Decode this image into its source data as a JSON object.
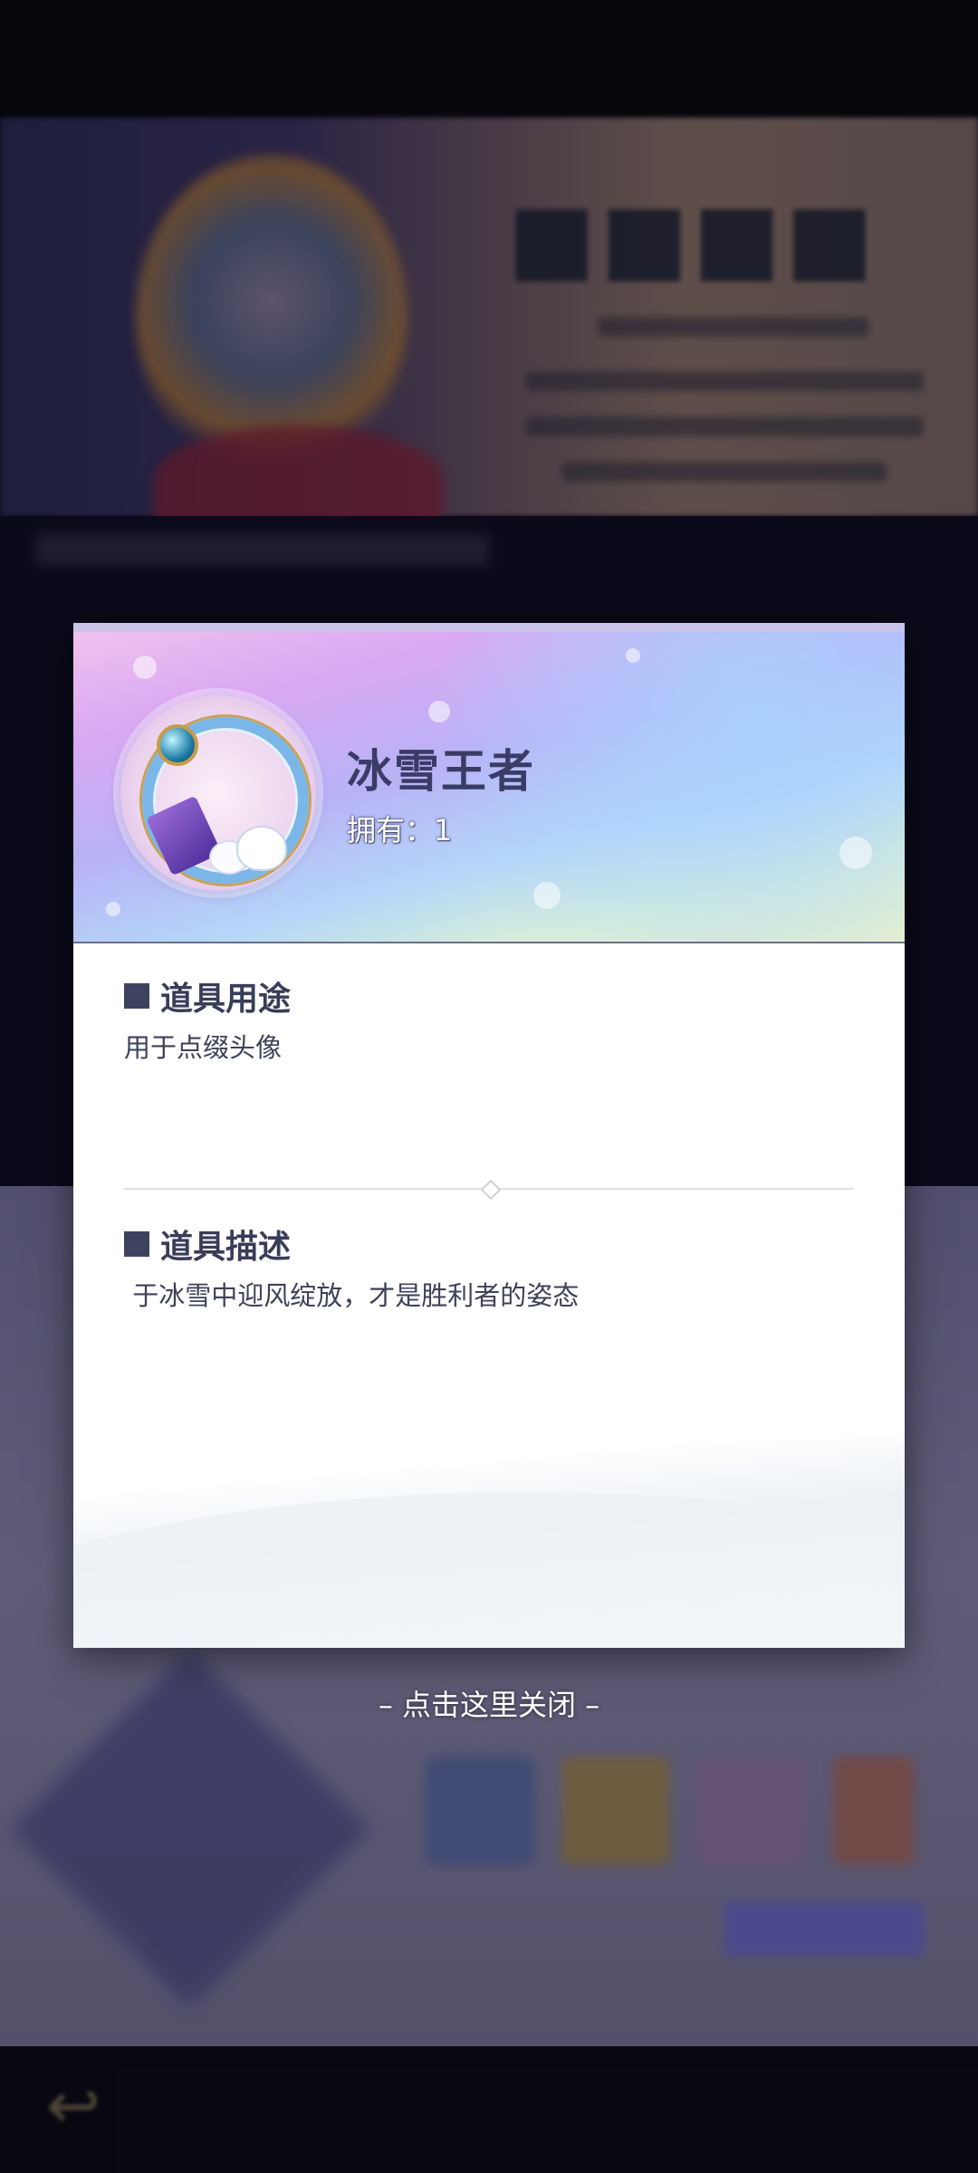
{
  "item": {
    "name": "冰雪王者",
    "owned": "拥有：1"
  },
  "usage": {
    "title": "道具用途",
    "text": "用于点缀头像"
  },
  "description": {
    "title": "道具描述",
    "text": " 于冰雪中迎风绽放，才是胜利者的姿态"
  },
  "close_hint": "– 点击这里关闭 –",
  "colors": {
    "title": "#3a3c66",
    "section_square": "#3e4260"
  }
}
